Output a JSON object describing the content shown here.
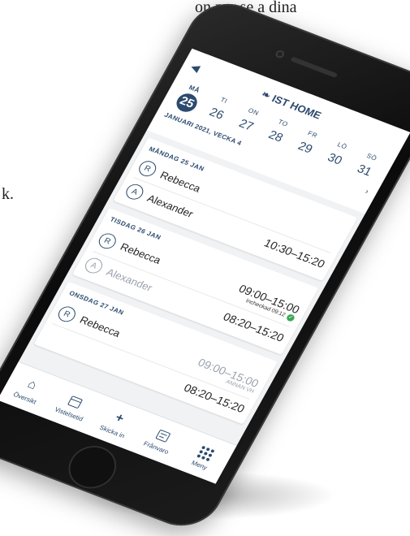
{
  "background": {
    "top_text": "on per se a dina",
    "side_text": "k."
  },
  "app": {
    "brand": "IST HOME",
    "back_icon": "chevron-left-icon",
    "accent_color": "#2c4a6e",
    "check_color": "#3aa757"
  },
  "week": {
    "label": "JANUARI 2021, VECKA 4",
    "days": [
      {
        "name": "MÅ",
        "date": "25",
        "selected": true
      },
      {
        "name": "TI",
        "date": "26"
      },
      {
        "name": "ON",
        "date": "27"
      },
      {
        "name": "TO",
        "date": "28"
      },
      {
        "name": "FR",
        "date": "29"
      },
      {
        "name": "LÖ",
        "date": "30"
      },
      {
        "name": "SÖ",
        "date": "31"
      }
    ]
  },
  "schedule": [
    {
      "title": "MÅNDAG 25 JAN",
      "rows": [
        {
          "initial": "R",
          "name": "Rebecca",
          "time": ""
        },
        {
          "initial": "A",
          "name": "Alexander",
          "time": "10:30–15:20"
        }
      ]
    },
    {
      "title": "TISDAG 26 JAN",
      "rows": [
        {
          "initial": "R",
          "name": "Rebecca",
          "time": "09:00–15:00",
          "sub": "Incheckad 09:12"
        },
        {
          "initial": "A",
          "name": "Alexander",
          "time": "08:20–15:20",
          "faded": true
        }
      ]
    },
    {
      "title": "ONSDAG 27 JAN",
      "rows": [
        {
          "initial": "R",
          "name": "Rebecca",
          "time": "09:00–15:00",
          "sub": "ANNAN VH",
          "faded_time": true
        },
        {
          "initial": "",
          "name": "",
          "time": "08:20–15:20"
        }
      ]
    }
  ],
  "tabs": [
    {
      "label": "Översikt",
      "icon": "home-icon"
    },
    {
      "label": "Vistelsetid",
      "icon": "calendar-icon"
    },
    {
      "label": "Skicka in",
      "icon": "plus-icon"
    },
    {
      "label": "Frånvaro",
      "icon": "document-icon"
    },
    {
      "label": "Meny",
      "icon": "grid-icon"
    }
  ]
}
